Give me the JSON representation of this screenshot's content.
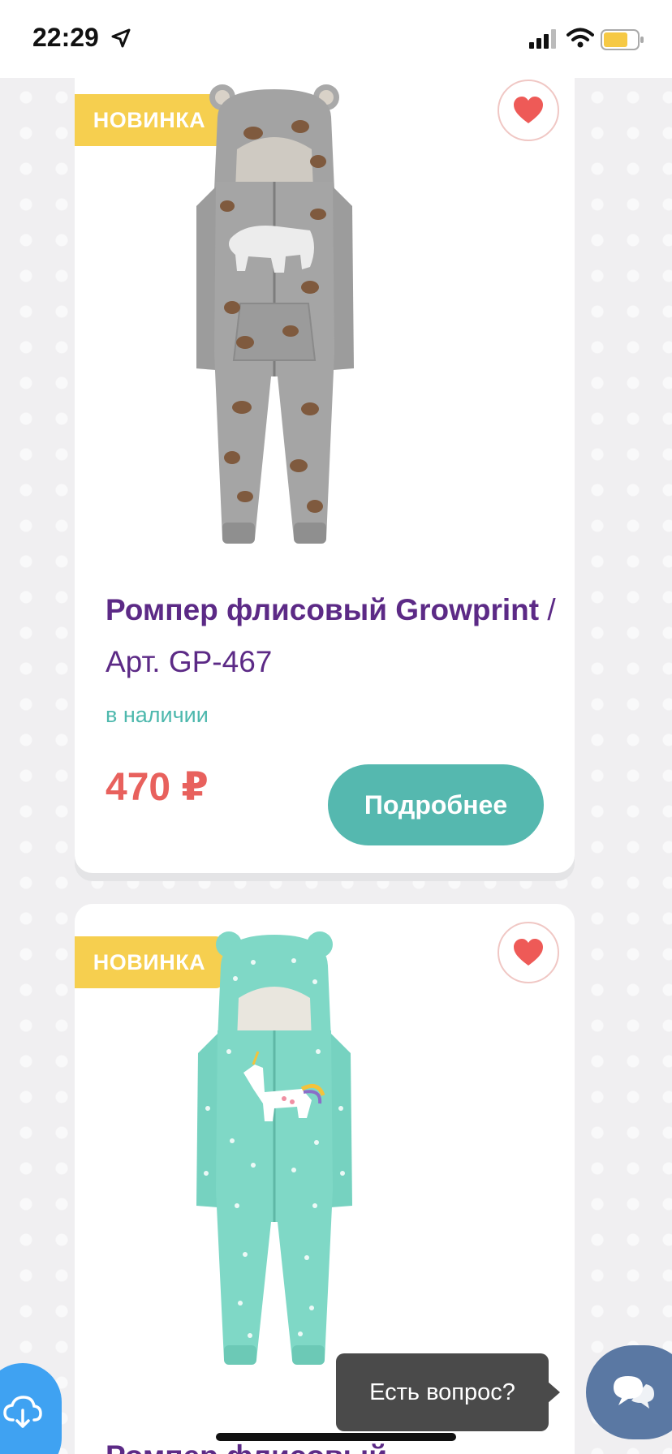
{
  "status_bar": {
    "time": "22:29",
    "icons": [
      "location-arrow-icon",
      "signal-icon",
      "wifi-icon",
      "battery-icon"
    ],
    "battery_color": "#f6c945"
  },
  "products": [
    {
      "badge": "НОВИНКА",
      "name": "Ромпер флисовый Growprint",
      "separator": " / ",
      "sku": "Арт. GP-467",
      "stock": "в наличии",
      "price": "470 ₽",
      "details_label": "Подробнее",
      "favorite": true,
      "image": "grey-bear-fleece-romper"
    },
    {
      "badge": "НОВИНКА",
      "name": "Ромпер флисовый",
      "favorite": true,
      "image": "mint-unicorn-fleece-romper"
    }
  ],
  "floating": {
    "tooltip": "Есть вопрос?",
    "chat_icon": "chat-bubbles-icon",
    "download_icon": "cloud-download-icon"
  },
  "colors": {
    "badge": "#f6cf4f",
    "title": "#5c2a86",
    "stock": "#4db8ad",
    "price": "#e8615d",
    "button": "#55b8af",
    "heart": "#ee5a57"
  }
}
